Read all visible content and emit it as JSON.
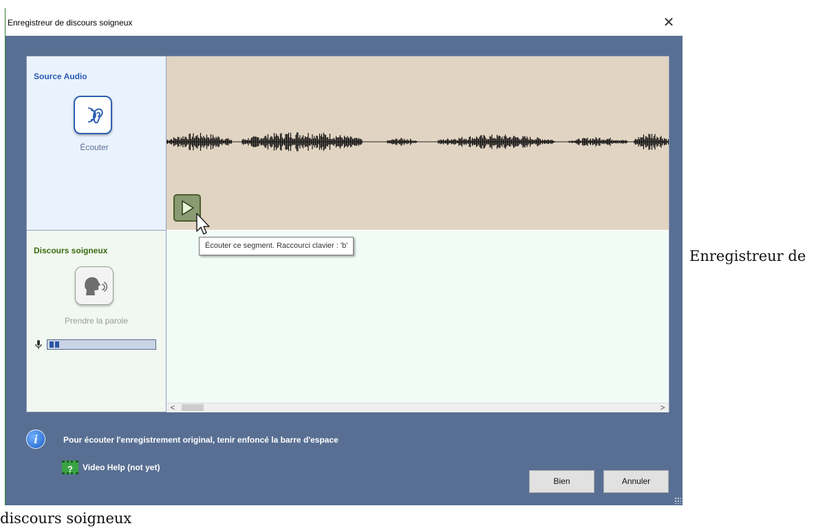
{
  "window": {
    "title": "Enregistreur de discours soigneux",
    "close_glyph": "✕"
  },
  "source": {
    "title": "Source Audio",
    "listen_label": "Écouter",
    "listen_icon": "ear-sound-icon"
  },
  "discours": {
    "title": "Discours soigneux",
    "speak_label": "Prendre la parole",
    "speak_icon": "speaking-head-icon",
    "mic_icon": "microphone-icon",
    "level_segments": 2
  },
  "waveform": {
    "play_icon": "play-icon",
    "tooltip": "Écouter ce segment. Raccourci clavier : 'b'"
  },
  "scrollbar": {
    "left_glyph": "<",
    "right_glyph": ">"
  },
  "footer": {
    "info_glyph": "i",
    "info_text": "Pour écouter l'enregistrement original, tenir enfoncé la barre d'espace",
    "help_glyph": "?",
    "help_text": "Video Help (not yet)",
    "ok_label": "Bien",
    "cancel_label": "Annuler"
  },
  "caption": {
    "line1": "Enregistreur de",
    "line2": "discours soigneux"
  },
  "colors": {
    "dialog_background": "#586f93",
    "source_section": "#eaf3fd",
    "discours_section": "#f1f8f1",
    "waveform_background": "#e1d4c2",
    "source_title": "#2a5ab4",
    "discours_title": "#3a6b10"
  }
}
